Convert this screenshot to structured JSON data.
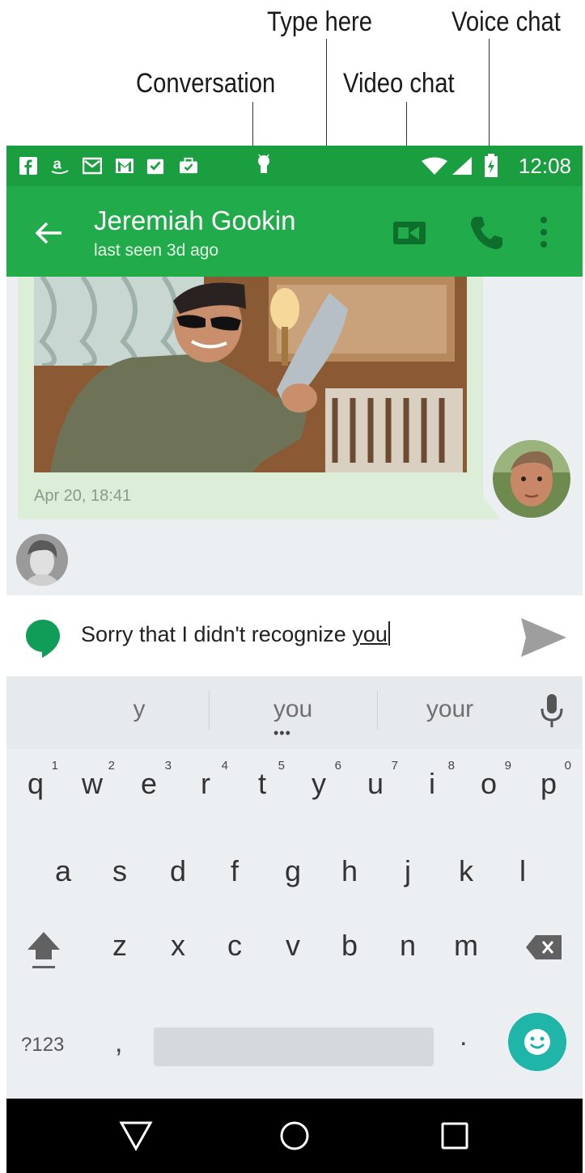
{
  "callouts": {
    "type_here": "Type here",
    "voice_chat": "Voice chat",
    "conversation": "Conversation",
    "video_chat": "Video chat"
  },
  "status_bar": {
    "time": "12:08",
    "notification_icons": [
      "facebook-icon",
      "amazon-icon",
      "gmail-icon",
      "gmail-icon",
      "tasks-check-icon",
      "briefcase-check-icon",
      "android-icon"
    ],
    "system_icons": [
      "wifi-icon",
      "signal-icon",
      "battery-charging-icon"
    ]
  },
  "app_bar": {
    "contact_name": "Jeremiah Gookin",
    "contact_status": "last seen 3d ago",
    "actions": [
      "video-call-icon",
      "phone-icon",
      "overflow-menu-icon"
    ]
  },
  "conversation": {
    "message_timestamp": "Apr 20, 18:41"
  },
  "compose": {
    "text_before": "Sorry that I didn't recognize ",
    "text_suggestion": "you"
  },
  "keyboard": {
    "suggestions": [
      "y",
      "you",
      "your"
    ],
    "suggestion_dots": "•••",
    "row1": [
      {
        "key": "q",
        "hint": "1"
      },
      {
        "key": "w",
        "hint": "2"
      },
      {
        "key": "e",
        "hint": "3"
      },
      {
        "key": "r",
        "hint": "4"
      },
      {
        "key": "t",
        "hint": "5"
      },
      {
        "key": "y",
        "hint": "6"
      },
      {
        "key": "u",
        "hint": "7"
      },
      {
        "key": "i",
        "hint": "8"
      },
      {
        "key": "o",
        "hint": "9"
      },
      {
        "key": "p",
        "hint": "0"
      }
    ],
    "row2": [
      "a",
      "s",
      "d",
      "f",
      "g",
      "h",
      "j",
      "k",
      "l"
    ],
    "row3": [
      "z",
      "x",
      "c",
      "v",
      "b",
      "n",
      "m"
    ],
    "symbols_label": "?123",
    "comma": ",",
    "period": "."
  },
  "colors": {
    "status_bar": "#1a9e3f",
    "app_bar": "#22ab4a",
    "bubble": "#dcedd8",
    "emoji_key": "#1fb5a8"
  }
}
